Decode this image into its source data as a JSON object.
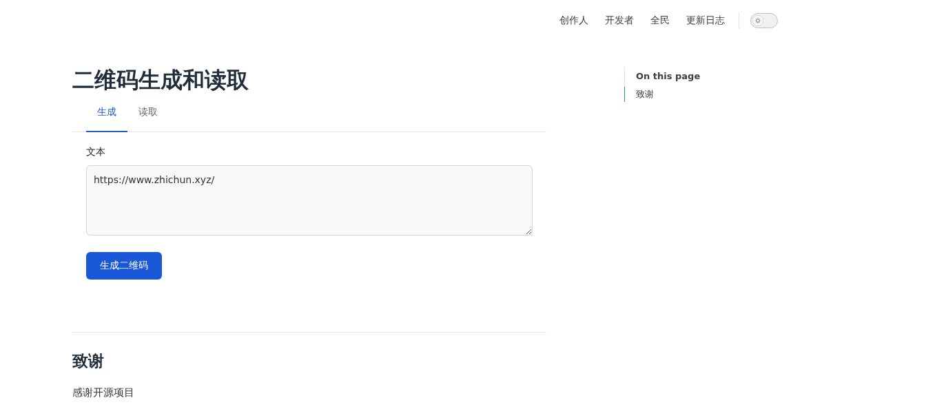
{
  "nav": {
    "links": [
      "创作人",
      "开发者",
      "全民",
      "更新日志"
    ],
    "dark_mode": false
  },
  "page": {
    "title": "二维码生成和读取",
    "tabs": [
      {
        "label": "生成",
        "selected": true
      },
      {
        "label": "读取",
        "selected": false
      }
    ],
    "field": {
      "label": "文本",
      "value": "https://www.zhichun.xyz/"
    },
    "button": "生成二维码",
    "section": {
      "heading": "致谢",
      "text": "感谢开源项目"
    }
  },
  "toc": {
    "title": "On this page",
    "items": [
      {
        "label": "致谢",
        "selected": true
      }
    ]
  }
}
